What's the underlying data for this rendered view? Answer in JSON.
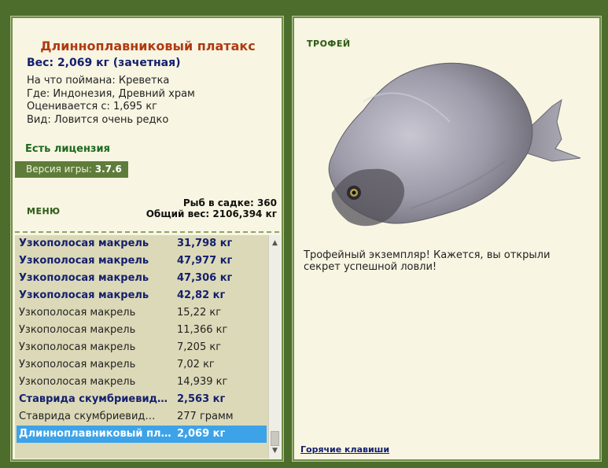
{
  "fish": {
    "title": "Длиннoплавниковый платакс",
    "weight": "Вес: 2,069 кг (зачетная)",
    "caught_with": "На что поймана: Креветка",
    "location": "Где: Индонезия, Древний храм",
    "valued_from": "Оценивается с: 1,695 кг",
    "rarity": "Вид: Ловится очень редко"
  },
  "license": "Есть лицензия",
  "version": {
    "label": "Версия игры:",
    "value": "3.7.6"
  },
  "menu_label": "МЕНЮ",
  "stats": {
    "count": "Рыб в садке: 360",
    "total": "Общий вес: 2106,394 кг"
  },
  "catch_list": [
    {
      "name": "Узкополосая макрель",
      "weight": "31,798 кг",
      "style": "bold"
    },
    {
      "name": "Узкополосая макрель",
      "weight": "47,977 кг",
      "style": "bold"
    },
    {
      "name": "Узкополосая макрель",
      "weight": "47,306 кг",
      "style": "bold"
    },
    {
      "name": "Узкополосая макрель",
      "weight": "42,82 кг",
      "style": "bold"
    },
    {
      "name": "Узкополосая макрель",
      "weight": "15,22 кг",
      "style": "reg"
    },
    {
      "name": "Узкополосая макрель",
      "weight": "11,366 кг",
      "style": "reg"
    },
    {
      "name": "Узкополосая макрель",
      "weight": "7,205 кг",
      "style": "reg"
    },
    {
      "name": "Узкополосая макрель",
      "weight": "7,02 кг",
      "style": "reg"
    },
    {
      "name": "Узкополосая макрель",
      "weight": "14,939 кг",
      "style": "reg"
    },
    {
      "name": "Ставрида скумбриевид…",
      "weight": "2,563 кг",
      "style": "bold"
    },
    {
      "name": "Ставрида скумбриевид…",
      "weight": "277 грамм",
      "style": "reg"
    },
    {
      "name": "Длиннoплавниковый пл…",
      "weight": "2,069 кг",
      "style": "sel"
    }
  ],
  "scroll": {
    "up_icon": "▲",
    "down_icon": "▼"
  },
  "trophy": {
    "label": "ТРОФЕЙ",
    "message": "Трофейный экземпляр! Кажется, вы открыли секрет успешной ловли!"
  },
  "hotkeys": "Горячие клавиши"
}
